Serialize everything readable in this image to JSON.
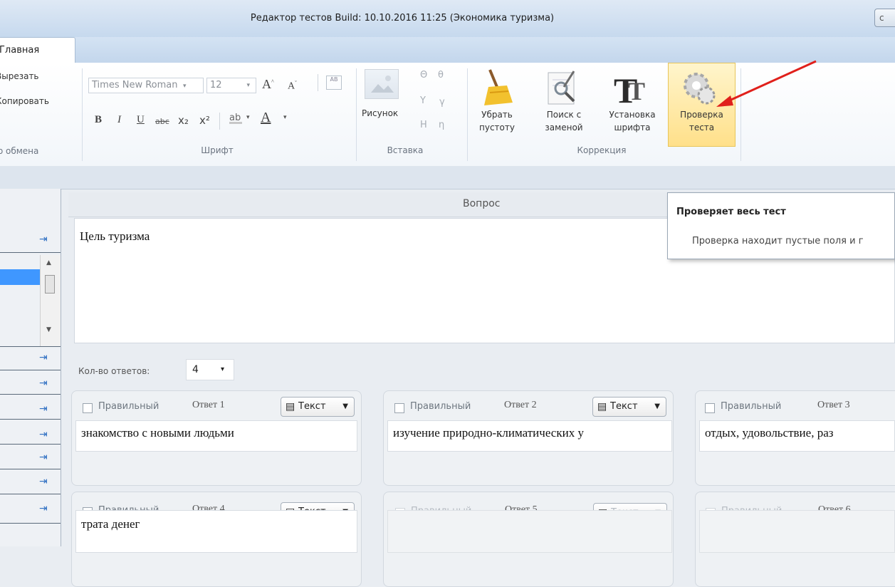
{
  "window": {
    "title": "Редактор тестов Build: 10.10.2016 11:25  (Экономика туризма)",
    "corner_button": "c"
  },
  "tabs": [
    {
      "label": "Главная",
      "active": true
    }
  ],
  "ribbon": {
    "clipboard": {
      "cut": "Вырезать",
      "copy": "Копировать",
      "group": "Буфер обмена"
    },
    "font": {
      "family": "Times New Roman",
      "size": "12",
      "group": "Шрифт",
      "buttons": [
        "B",
        "I",
        "U",
        "abc",
        "x₂",
        "x²"
      ]
    },
    "insert": {
      "picture": "Рисунок",
      "symbols": [
        "Θ",
        "θ",
        "Υ",
        "γ",
        "Η",
        "η"
      ],
      "group": "Вставка"
    },
    "correction": {
      "remove_empty": [
        "Убрать",
        "пустоту"
      ],
      "find_replace": [
        "Поиск с",
        "заменой"
      ],
      "set_font": [
        "Установка",
        "шрифта"
      ],
      "check_test": [
        "Проверка",
        "теста"
      ],
      "group": "Коррекция"
    }
  },
  "question": {
    "header": "Вопрос",
    "text": "Цель туризма"
  },
  "answers_count": {
    "label": "Кол-во ответов:",
    "value": "4"
  },
  "answers": [
    {
      "correct_label": "Правильный",
      "number": "Ответ 1",
      "type": "Текст",
      "text": "знакомство с новыми людьми",
      "enabled": true
    },
    {
      "correct_label": "Правильный",
      "number": "Ответ 2",
      "type": "Текст",
      "text": "изучение природно-климатических у",
      "enabled": true
    },
    {
      "correct_label": "Правильный",
      "number": "Ответ 3",
      "type": "",
      "text": "отдых, удовольствие, раз",
      "enabled": true
    },
    {
      "correct_label": "Правильный",
      "number": "Ответ 4",
      "type": "Текст",
      "text": "трата денег",
      "enabled": true
    },
    {
      "correct_label": "Правильный",
      "number": "Ответ 5",
      "type": "Текст",
      "text": "",
      "enabled": false
    },
    {
      "correct_label": "Правильный",
      "number": "Ответ 6",
      "type": "",
      "text": "",
      "enabled": false
    }
  ],
  "tooltip": {
    "title": "Проверяет весь тест",
    "body": "Проверка находит пустые поля и г"
  },
  "colors": {
    "accent": "#3f97ff",
    "highlight": "#ffe08a",
    "arrow": "#e0201b"
  }
}
